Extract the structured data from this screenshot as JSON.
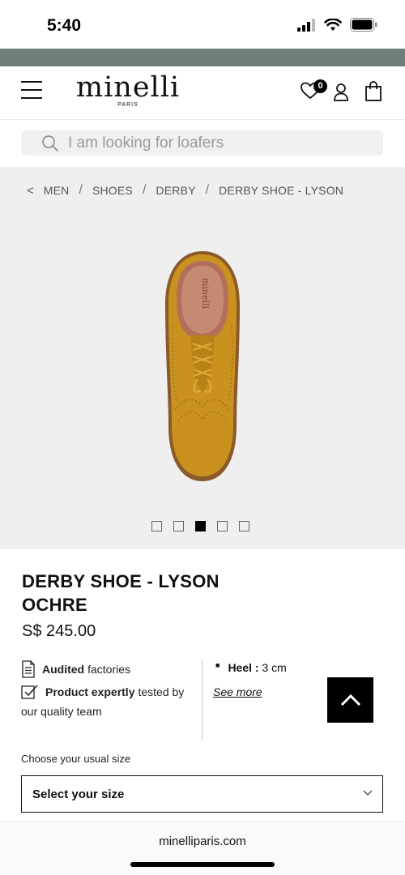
{
  "status_bar": {
    "time": "5:40"
  },
  "header": {
    "logo_text": "minelli",
    "logo_sub": "PARIS",
    "wishlist_count": "0"
  },
  "search": {
    "placeholder": "I am looking for loafers"
  },
  "breadcrumb": {
    "items": [
      "MEN",
      "SHOES",
      "DERBY",
      "DERBY SHOE - LYSON"
    ]
  },
  "gallery": {
    "image_count": 5,
    "active_index": 3
  },
  "product": {
    "title_line1": "DERBY SHOE - LYSON",
    "title_line2": "OCHRE",
    "price": "S$ 245.00"
  },
  "features": {
    "audited_bold": "Audited",
    "audited_rest": "factories",
    "tested_bold": "Product expertly",
    "tested_rest": "tested by",
    "tested_cont": "our quality team"
  },
  "details": {
    "heel_label": "Heel :",
    "heel_value": "3 cm",
    "see_more": "See more"
  },
  "size": {
    "label": "Choose your usual size",
    "select_placeholder": "Select your size"
  },
  "browser": {
    "url": "minelliparis.com"
  },
  "colors": {
    "promo_strip": "#6e7f7b",
    "gallery_bg": "#efefef",
    "shoe": "#c9921f"
  }
}
